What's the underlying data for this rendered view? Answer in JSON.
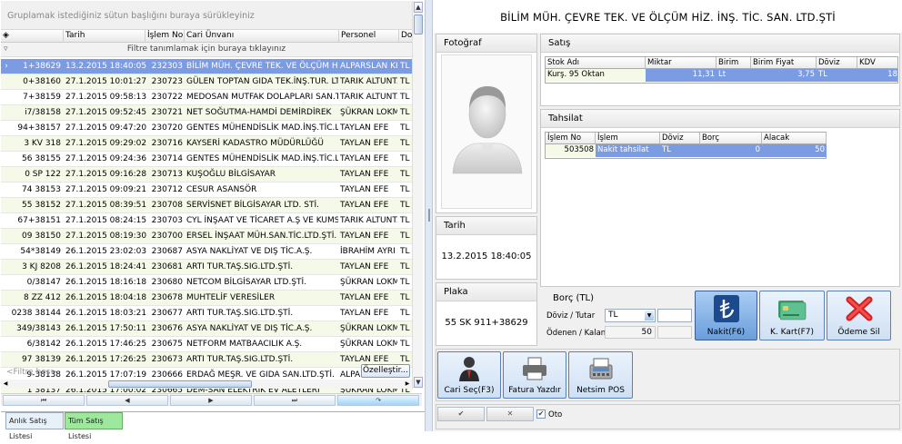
{
  "grid": {
    "group_panel": "Gruplamak istediğiniz sütun başlığını buraya sürükleyiniz",
    "columns": [
      "",
      "Tarih",
      "İşlem No",
      "Cari Ünvanı",
      "Personel",
      "Do"
    ],
    "filter_row": "Filtre tanımlamak için buraya tıklayınız",
    "rows": [
      {
        "plaka": "1+38629",
        "tarih": "13.2.2015 18:40:05",
        "islem": "232303",
        "cari": "BİLİM MÜH. ÇEVRE TEK. VE ÖLÇÜM HİZ.",
        "personel": "ALPARSLAN KII",
        "doviz": "TL"
      },
      {
        "plaka": "0+38160",
        "tarih": "27.1.2015 10:01:27",
        "islem": "230723",
        "cari": "GÜLEN TOPTAN GIDA TEK.İNŞ.TUR. LTD",
        "personel": "TARIK ALTUNT.",
        "doviz": "TL"
      },
      {
        "plaka": "7+38159",
        "tarih": "27.1.2015 09:58:13",
        "islem": "230722",
        "cari": "MEDOSAN MUTFAK DOLAPLARI SAN.TİC",
        "personel": "TARIK ALTUNT.",
        "doviz": "TL"
      },
      {
        "plaka": "i7/38158",
        "tarih": "27.1.2015 09:52:45",
        "islem": "230721",
        "cari": "NET SOĞUTMA-HAMDİ DEMİRDİREK",
        "personel": "ŞÜKRAN LOKM.",
        "doviz": "TL"
      },
      {
        "plaka": "94+38157",
        "tarih": "27.1.2015 09:47:20",
        "islem": "230720",
        "cari": "GENTES MÜHENDİSLİK MAD.İNŞ.TİC.LTD",
        "personel": "TAYLAN EFE",
        "doviz": "TL"
      },
      {
        "plaka": "3 KV  318",
        "tarih": "27.1.2015 09:29:02",
        "islem": "230716",
        "cari": "KAYSERİ KADASTRO MÜDÜRLÜĞÜ",
        "personel": "TAYLAN EFE",
        "doviz": "TL"
      },
      {
        "plaka": "56  38155",
        "tarih": "27.1.2015 09:24:36",
        "islem": "230714",
        "cari": "GENTES MÜHENDİSLİK MAD.İNŞ.TİC.LTD",
        "personel": "TAYLAN EFE",
        "doviz": "TL"
      },
      {
        "plaka": "0 SP  122",
        "tarih": "27.1.2015 09:16:28",
        "islem": "230713",
        "cari": "KUŞOĞLU BİLGİSAYAR",
        "personel": "TAYLAN EFE",
        "doviz": "TL"
      },
      {
        "plaka": "74  38153",
        "tarih": "27.1.2015 09:09:21",
        "islem": "230712",
        "cari": "CESUR ASANSÖR",
        "personel": "TAYLAN EFE",
        "doviz": "TL"
      },
      {
        "plaka": "55  38152",
        "tarih": "27.1.2015 08:39:51",
        "islem": "230708",
        "cari": "SERVİSNET BİLGİSAYAR LTD. STİ.",
        "personel": "TAYLAN EFE",
        "doviz": "TL"
      },
      {
        "plaka": "67+38151",
        "tarih": "27.1.2015 08:24:15",
        "islem": "230703",
        "cari": "CYL İNŞAAT VE TİCARET A.Ş VE KUMSA",
        "personel": "TARIK ALTUNT.",
        "doviz": "TL"
      },
      {
        "plaka": "09  38150",
        "tarih": "27.1.2015 08:19:30",
        "islem": "230700",
        "cari": "ERSEL İNŞAAT MÜH.SAN.TİC.LTD.ŞTİ.",
        "personel": "TAYLAN EFE",
        "doviz": "TL"
      },
      {
        "plaka": "54*38149",
        "tarih": "26.1.2015 23:02:03",
        "islem": "230687",
        "cari": "ASYA NAKLİYAT VE DIŞ TİC.A.Ş.",
        "personel": "İBRAHİM AYRI",
        "doviz": "TL"
      },
      {
        "plaka": "3 KJ  8208",
        "tarih": "26.1.2015 18:24:41",
        "islem": "230681",
        "cari": "ARTI TUR.TAŞ.SIG.LTD.ŞTİ.",
        "personel": "TAYLAN EFE",
        "doviz": "TL"
      },
      {
        "plaka": "0/38147",
        "tarih": "26.1.2015 18:16:18",
        "islem": "230680",
        "cari": "NETCOM BİLGİSAYAR LTD.ŞTİ.",
        "personel": "ŞÜKRAN LOKM.",
        "doviz": "TL"
      },
      {
        "plaka": "8 ZZ  412",
        "tarih": "26.1.2015 18:04:18",
        "islem": "230678",
        "cari": "MUHTELİF VERESİLER",
        "personel": "TAYLAN EFE",
        "doviz": "TL"
      },
      {
        "plaka": "0238  38144",
        "tarih": "26.1.2015 18:03:21",
        "islem": "230677",
        "cari": "ARTI TUR.TAŞ.SIG.LTD.ŞTİ.",
        "personel": "TAYLAN EFE",
        "doviz": "TL"
      },
      {
        "plaka": "349/38143",
        "tarih": "26.1.2015 17:50:11",
        "islem": "230676",
        "cari": "ASYA NAKLİYAT VE DIŞ TİC.A.Ş.",
        "personel": "ŞÜKRAN LOKM.",
        "doviz": "TL"
      },
      {
        "plaka": "6/38142",
        "tarih": "26.1.2015 17:46:25",
        "islem": "230675",
        "cari": "NETFORM MATBAACILIK A.Ş.",
        "personel": "ŞÜKRAN LOKM.",
        "doviz": "TL"
      },
      {
        "plaka": "97  38139",
        "tarih": "26.1.2015 17:26:25",
        "islem": "230673",
        "cari": "ARTI TUR.TAŞ.SIG.LTD.ŞTİ.",
        "personel": "TAYLAN EFE",
        "doviz": "TL"
      },
      {
        "plaka": "9-38138",
        "tarih": "26.1.2015 17:07:19",
        "islem": "230666",
        "cari": "ERDAĞ MEŞR. VE GIDA SAN.LTD.ŞTİ.",
        "personel": "ALPARSLAN KII",
        "doviz": "TL"
      },
      {
        "plaka": "1 38137",
        "tarih": "26.1.2015 17:00:02",
        "islem": "230665",
        "cari": "DEM-SAN ELEKTRİK EV ALETLERİ",
        "personel": "ŞÜKRAN LOKM.",
        "doviz": "TL"
      }
    ],
    "filter_empty": "<Filtre boş>",
    "customize_btn": "Özelleştir..."
  },
  "tabs": {
    "t1": "Anlık Satış Listesi",
    "t2": "Tüm Satış Listesi"
  },
  "company_title": "BİLİM MÜH. ÇEVRE TEK. VE ÖLÇÜM HİZ. İNŞ. TİC. SAN. LTD.ŞTİ",
  "photo": {
    "title": "Fotoğraf"
  },
  "tarih": {
    "title": "Tarih",
    "value": "13.2.2015 18:40:05"
  },
  "plaka": {
    "title": "Plaka",
    "value": "55 SK 911+38629"
  },
  "satis": {
    "title": "Satış",
    "columns": [
      "Stok Adı",
      "Miktar",
      "Birim",
      "Birim Fiyat",
      "Döviz",
      "KDV"
    ],
    "row": {
      "stok": "Kurş. 95 Oktan",
      "miktar": "11,31",
      "birim": "Lt",
      "fiyat": "3,75",
      "doviz": "TL",
      "kdv": "18"
    }
  },
  "tahsilat": {
    "title": "Tahsilat",
    "columns": [
      "İşlem No",
      "İşlem",
      "Döviz",
      "Borç",
      "Alacak"
    ],
    "row": {
      "no": "503508",
      "islem": "Nakit tahsilat",
      "doviz": "TL",
      "borc": "0",
      "alacak": "50"
    }
  },
  "borc": {
    "title": "Borç (TL)",
    "doviz_label": "Döviz  /  Tutar",
    "doviz_value": "TL",
    "odenen_label": "Ödenen / Kalan",
    "odenen_value": "50"
  },
  "buttons": {
    "nakit": "Nakit(F6)",
    "kkart": "K. Kart(F7)",
    "odeme_sil": "Ödeme Sil",
    "cari_sec": "Cari Seç(F3)",
    "fatura": "Fatura Yazdır",
    "netsim": "Netsim POS",
    "oto": "Oto"
  }
}
